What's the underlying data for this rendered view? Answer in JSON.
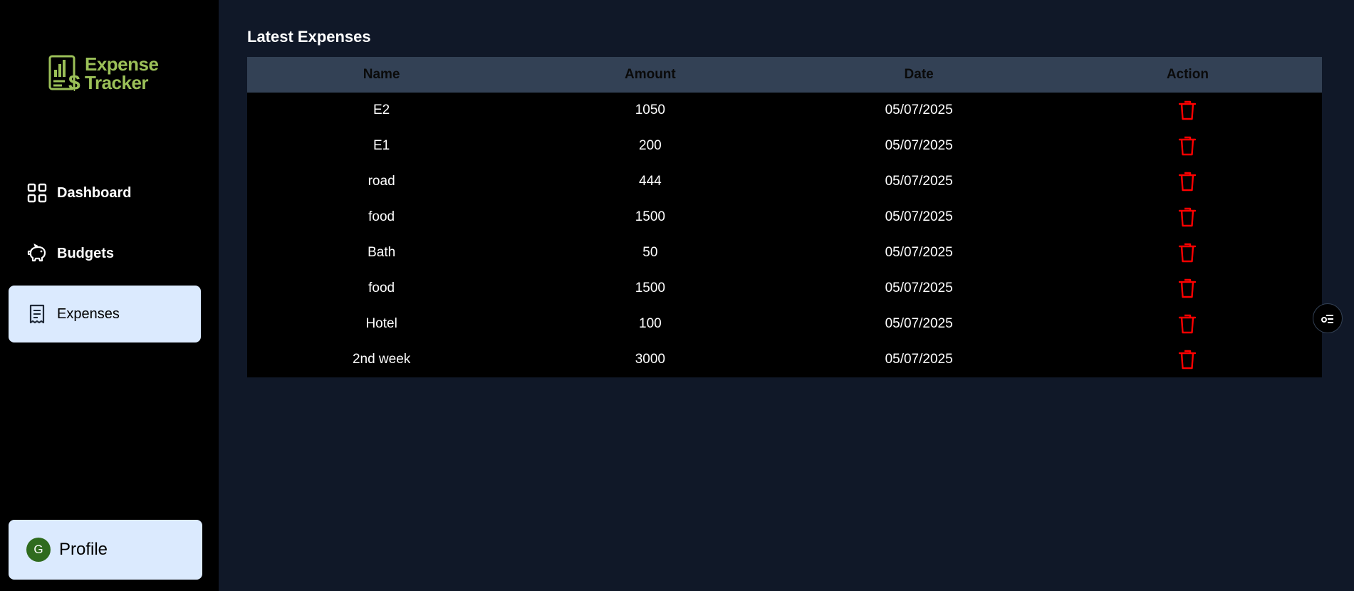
{
  "brand": {
    "line1": "Expense",
    "line2": "Tracker",
    "color": "#9bc058",
    "icon": "receipt-dollar-chart-icon"
  },
  "sidebar": {
    "items": [
      {
        "label": "Dashboard",
        "icon": "grid-icon",
        "active": false
      },
      {
        "label": "Budgets",
        "icon": "piggy-bank-icon",
        "active": false
      },
      {
        "label": "Expenses",
        "icon": "receipt-icon",
        "active": true
      }
    ],
    "profile": {
      "initial": "G",
      "label": "Profile"
    }
  },
  "main": {
    "title": "Latest Expenses",
    "table": {
      "headers": [
        "Name",
        "Amount",
        "Date",
        "Action"
      ],
      "rows": [
        {
          "name": "E2",
          "amount": "1050",
          "date": "05/07/2025"
        },
        {
          "name": "E1",
          "amount": "200",
          "date": "05/07/2025"
        },
        {
          "name": "road",
          "amount": "444",
          "date": "05/07/2025"
        },
        {
          "name": "food",
          "amount": "1500",
          "date": "05/07/2025"
        },
        {
          "name": "Bath",
          "amount": "50",
          "date": "05/07/2025"
        },
        {
          "name": "food",
          "amount": "1500",
          "date": "05/07/2025"
        },
        {
          "name": "Hotel",
          "amount": "100",
          "date": "05/07/2025"
        },
        {
          "name": "2nd week",
          "amount": "3000",
          "date": "05/07/2025"
        }
      ],
      "action_icon": "trash-icon",
      "action_color": "#ff0000"
    }
  },
  "floating_button": {
    "icon": "settings-list-icon"
  },
  "colors": {
    "background": "#101828",
    "sidebar": "#000000",
    "active_nav": "#dbeafe",
    "table_header": "#334155",
    "avatar": "#2f6b1e"
  }
}
